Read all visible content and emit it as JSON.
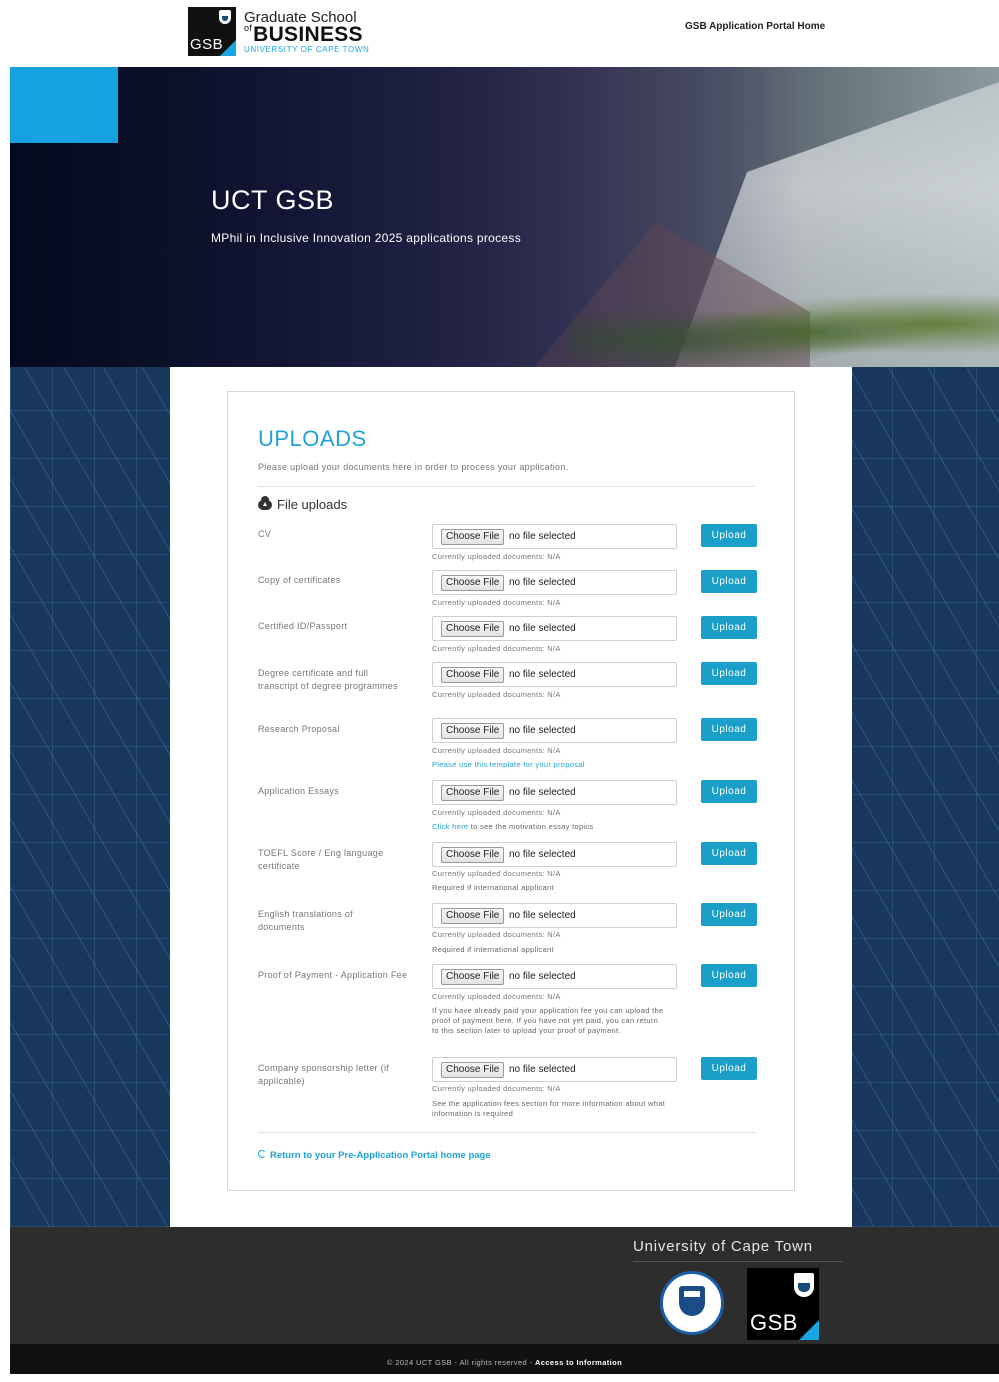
{
  "header": {
    "logo_line1": "Graduate School",
    "logo_of": "of",
    "logo_line2": "BUSINESS",
    "logo_line3": "UNIVERSITY OF CAPE TOWN",
    "logo_box_text": "GSB",
    "nav_link": "GSB Application Portal Home"
  },
  "hero": {
    "title": "UCT GSB",
    "subtitle": "MPhil in Inclusive Innovation 2025 applications process"
  },
  "uploads": {
    "title": "UPLOADS",
    "description": "Please upload your documents here in order to process your application.",
    "section_heading": "File uploads",
    "choose_label": "Choose File",
    "no_file_label": "no file selected",
    "upload_label": "Upload",
    "current_docs": "Currently uploaded documents: N/A",
    "rows": [
      {
        "label": "CV"
      },
      {
        "label": "Copy of certificates"
      },
      {
        "label": "Certified ID/Passport"
      },
      {
        "label": "Degree certificate and full transcript of degree programmes"
      },
      {
        "label": "Research Proposal",
        "note_link": "Please use this template for your proposal"
      },
      {
        "label": "Application Essays",
        "note_link": "Click here",
        "note_text": " to see the motivation essay topics"
      },
      {
        "label": "TOEFL Score / Eng language certificate",
        "note_text": "Required if international applicant"
      },
      {
        "label": "English translations of documents",
        "note_text": "Required if international applicant"
      },
      {
        "label": "Proof of Payment - Application Fee",
        "note_text": "If you have already paid your application fee you can upload the proof of payment here. If you have not yet paid, you can return to this section later to upload your proof of payment."
      },
      {
        "label": "Company sponsorship letter (if applicable)",
        "note_text": "See the application fees section for more information about what information is required"
      }
    ],
    "return_link": "Return to your Pre-Application Portal home page"
  },
  "footer": {
    "title": "University of Cape Town",
    "gsb_text": "GSB",
    "copyright": "© 2024 UCT GSB - All rights reserved - ",
    "access_link": "Access to Information"
  },
  "colors": {
    "accent": "#1fa3d8",
    "button": "#1aa0c8",
    "pattern": "#17385a",
    "footer": "#2d2d2d"
  }
}
